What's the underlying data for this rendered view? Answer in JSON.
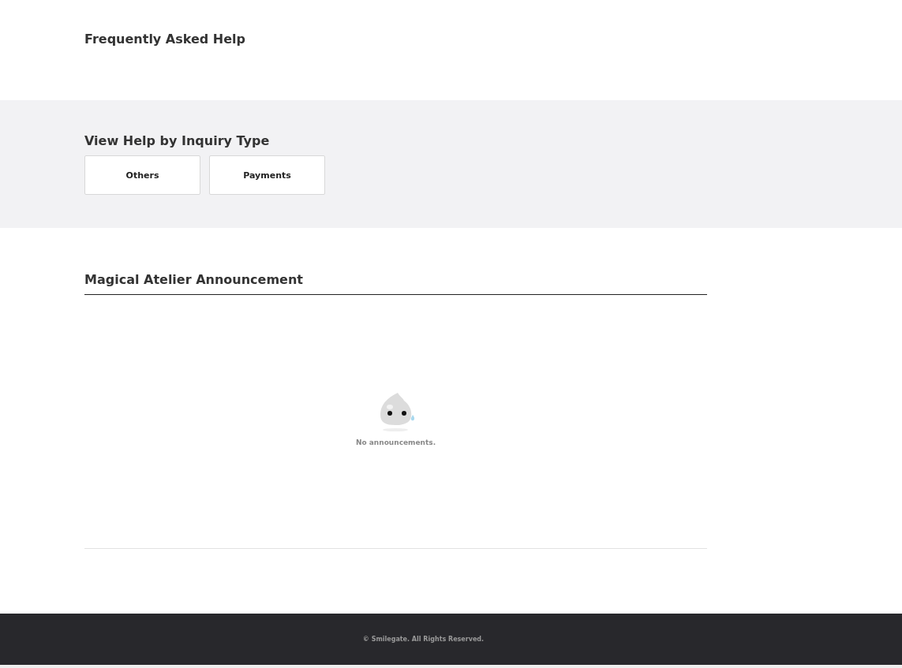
{
  "faq": {
    "title": "Frequently Asked Help"
  },
  "inquiry": {
    "title": "View Help by Inquiry Type",
    "types": [
      "Others",
      "Payments"
    ]
  },
  "announcements": {
    "title": "Magical Atelier Announcement",
    "empty_message": "No announcements."
  },
  "footer": {
    "copyright": "© Smilegate. All Rights Reserved."
  }
}
